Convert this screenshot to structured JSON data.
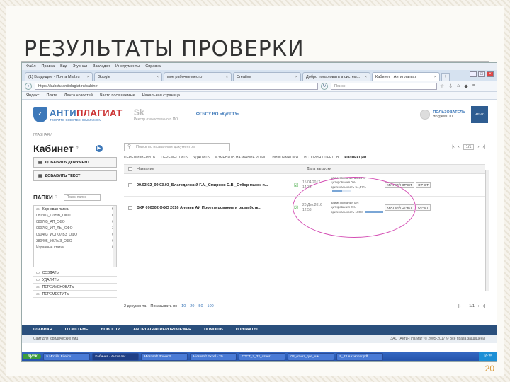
{
  "slide": {
    "title": "РЕЗУЛЬТАТЫ ПРОВЕРКИ",
    "number": "20"
  },
  "browser": {
    "menu": [
      "Файл",
      "Правка",
      "Вид",
      "Журнал",
      "Закладки",
      "Инструменты",
      "Справка"
    ],
    "tabs": [
      {
        "label": "(1) Входящие - Почта Mail.ru"
      },
      {
        "label": "Google"
      },
      {
        "label": "мое рабочее место"
      },
      {
        "label": "Creative"
      },
      {
        "label": "Добро пожаловать в систем..."
      },
      {
        "label": "Кабинет · Антиплагиат"
      }
    ],
    "url": "https://kubstu.antiplagiat.ru/cabinet",
    "search_placeholder": "Поиск",
    "bookmarks": [
      "Яндекс",
      "Почта",
      "Лента новостей",
      "Часто посещаемые",
      "Начальная страница"
    ]
  },
  "site": {
    "logo_main": "АНТИ",
    "logo_accent": "ПЛАГИАТ",
    "logo_tagline": "ТВОРИТЕ СОБСТВЕННЫМ УМОМ",
    "registry_mark": "Sk",
    "registry_text": "Реестр отечественного ПО",
    "org": "ФГБОУ ВО «КубГТУ»",
    "user_title": "ПОЛЬЗОВАТЕЛЬ",
    "user_email": "dk@kstu.ru",
    "menu_label": "МЕНЮ",
    "breadcrumb": "ГЛАВНАЯ  /",
    "cabinet_title": "Кабинет",
    "add_doc": "ДОБАВИТЬ ДОКУМЕНТ",
    "add_text": "ДОБАВИТЬ ТЕКСТ",
    "folders_title": "ПАПКИ",
    "folder_search": "Поиск папок",
    "folders": [
      {
        "name": "Корневая папка",
        "count": "0"
      },
      {
        "name": "080303_ПЛЫВ_ОФО",
        "count": "0"
      },
      {
        "name": "080705_АП_ОФО",
        "count": "0"
      },
      {
        "name": "090702_ИП_ЛЫ_ОФО",
        "count": "2"
      },
      {
        "name": "090403_ИСПОЛЬЗ_ОФО",
        "count": "0"
      },
      {
        "name": "380405_УКЛЫЗ_ОФО",
        "count": "0"
      },
      {
        "name": "Изданные статьи",
        "count": "0"
      }
    ],
    "folder_actions": [
      "СОЗДАТЬ",
      "УДАЛИТЬ",
      "ПЕРЕИМЕНОВАТЬ",
      "ПЕРЕМЕСТИТЬ"
    ],
    "doc_search_placeholder": "Поиск по названиям документов",
    "page_indicator": "1/1",
    "toolbar": [
      "ПЕРЕПРОВЕРИТЬ",
      "ПЕРЕМЕСТИТЬ",
      "УДАЛИТЬ",
      "ИЗМЕНИТЬ НАЗВАНИЕ И ТИП",
      "ИНФОРМАЦИЯ",
      "ИСТОРИЯ ОТЧЕТОВ"
    ],
    "collections_label": "КОЛЛЕКЦИИ",
    "col_name": "Название",
    "col_date": "Дата загрузки",
    "documents": [
      {
        "name": "09.03.02_09.03.03_Благодатский Г.А._Смирнов С.В._Отбор масок п...",
        "date": "15.04.2017",
        "time": "14:38",
        "borrow": "заимствования  54,43%",
        "cite": "цитирования  0%",
        "orig": "оригинальность  54,57%",
        "orig_frac": 0.55,
        "btn_short": "КРАТКИЙ ОТЧЕТ",
        "btn_report": "ОТЧЕТ"
      },
      {
        "name": "ВКР 090302 ОФО 2016 Алеаев АИ Проектирование и разработк...",
        "date": "20.Дек.2016",
        "time": "12:53",
        "borrow": "заимствования  0%",
        "cite": "цитирования  0%",
        "orig": "оригинальность  100%",
        "orig_frac": 1.0,
        "btn_short": "КРАТКИЙ ОТЧЕТ",
        "btn_report": "ОТЧЕТ"
      }
    ],
    "doc_count": "2 документа",
    "show_by": "Показывать по",
    "show_opts": [
      "10",
      "20",
      "50",
      "100"
    ],
    "footer_menu": [
      "ГЛАВНАЯ",
      "О СИСТЕМЕ",
      "НОВОСТИ",
      "ANTIPLAGIAT.REPORTVIEWER",
      "ПОМОЩЬ",
      "КОНТАКТЫ"
    ],
    "footer_left": "Сайт для юридических лиц",
    "footer_copy": "ЗАО \"Анти-Плагиат\" © 2005-2017 © Все права защищены"
  },
  "taskbar": {
    "start": "пуск",
    "items": [
      "5 Mozilla Firefox",
      "Кабинет · Антиплаг...",
      "Microsoft PowerP...",
      "Microsoft Excel - 20...",
      "ГОСТ_7_32_отчет",
      "03_отчет_доп_шм...",
      "9_23 Антиплаг.pdf"
    ],
    "clock": "16:25"
  },
  "colors": {
    "brand_blue": "#3d78b9",
    "footer_blue": "#2a4f7c",
    "highlight_ellipse": "#d44fb4"
  }
}
